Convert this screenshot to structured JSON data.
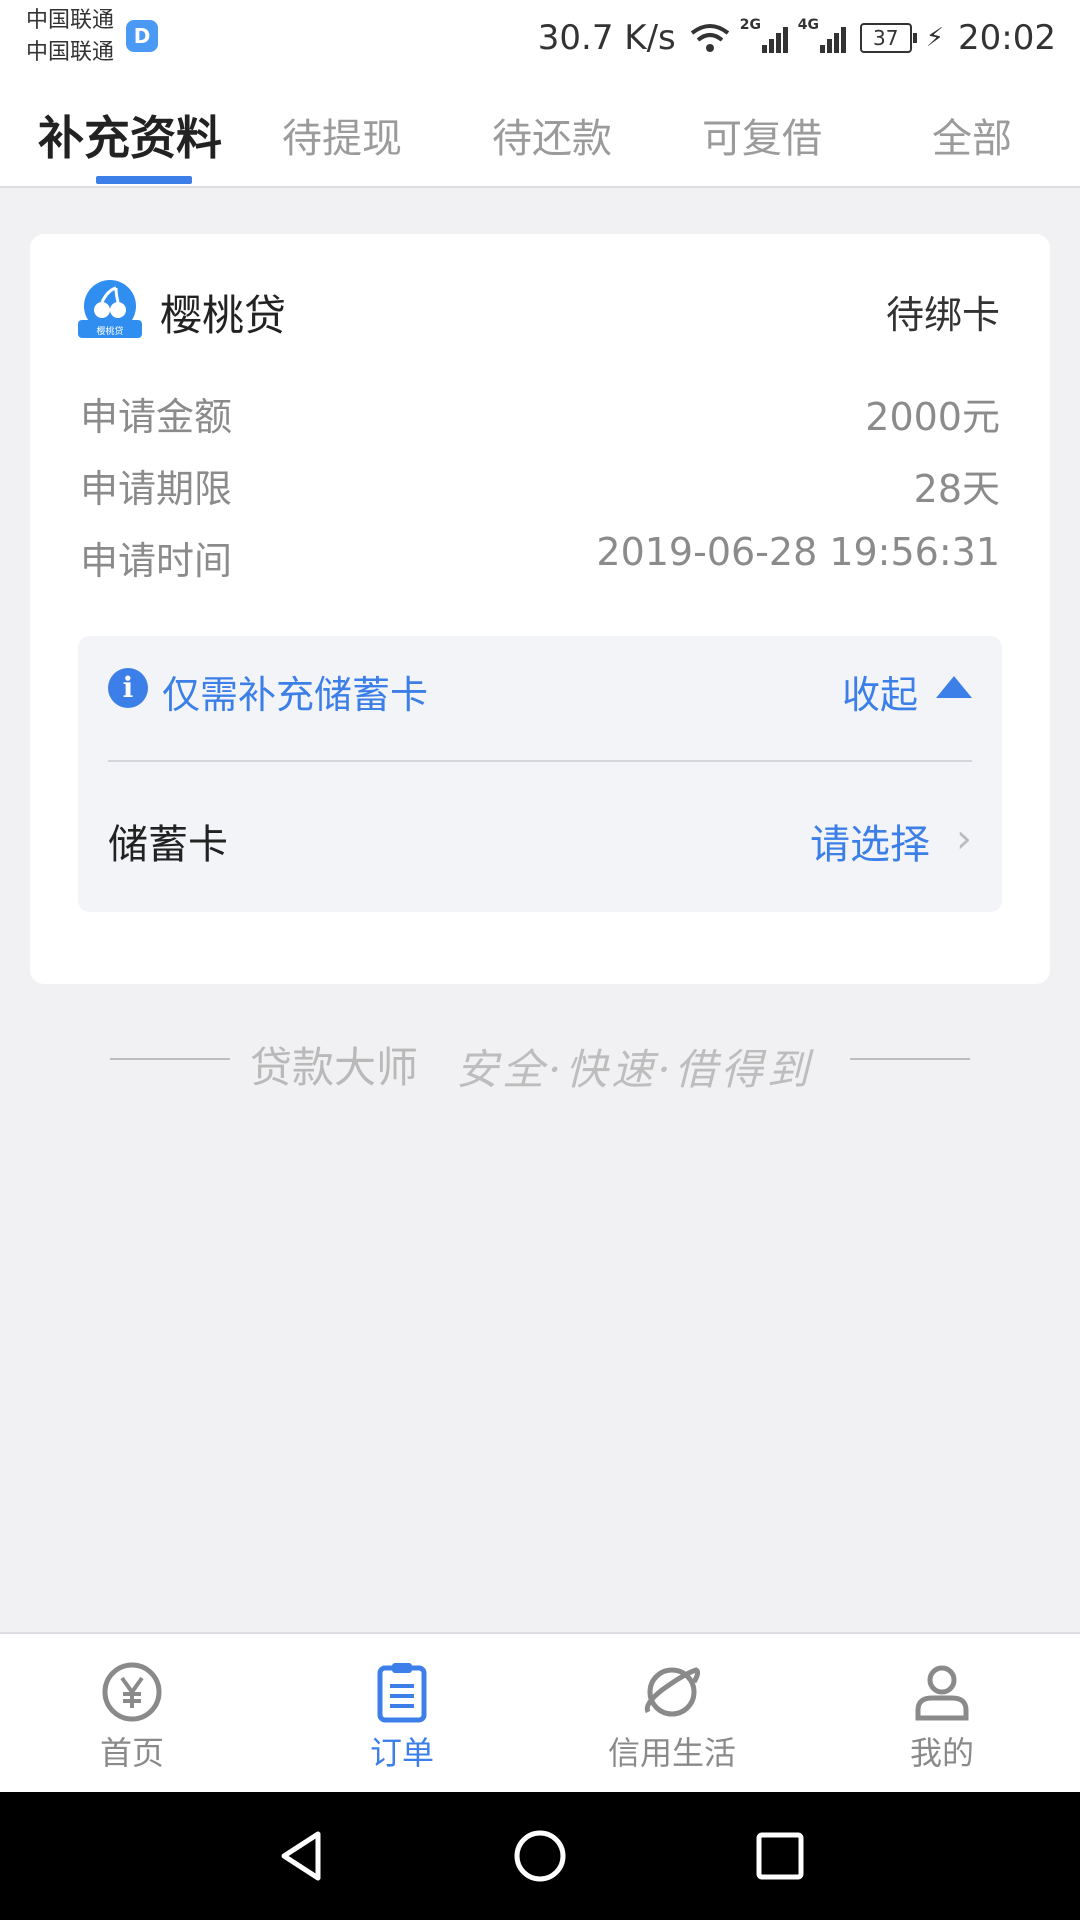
{
  "status_bar": {
    "carrier1": "中国联通",
    "carrier2": "中国联通",
    "app_badge": "D",
    "speed": "30.7 K/s",
    "net1": "2G",
    "net2": "4G",
    "battery": "37",
    "time": "20:02"
  },
  "tabs": [
    {
      "label": "补充资料",
      "active": true
    },
    {
      "label": "待提现"
    },
    {
      "label": "待还款"
    },
    {
      "label": "可复借"
    },
    {
      "label": "全部"
    }
  ],
  "order": {
    "lender": "樱桃贷",
    "logo_caption": "樱桃贷",
    "status": "待绑卡",
    "rows": [
      {
        "label": "申请金额",
        "value": "2000元"
      },
      {
        "label": "申请期限",
        "value": "28天"
      },
      {
        "label": "申请时间",
        "value": "2019-06-28 19:56:31"
      }
    ],
    "notice": "仅需补充储蓄卡",
    "collapse_label": "收起",
    "card_label": "储蓄卡",
    "select_label": "请选择"
  },
  "slogan": {
    "brand": "贷款大师",
    "tagline": "安全·快速·借得到"
  },
  "bottom_nav": [
    {
      "label": "首页",
      "icon": "yen-circle-icon"
    },
    {
      "label": "订单",
      "icon": "clipboard-icon",
      "active": true
    },
    {
      "label": "信用生活",
      "icon": "planet-icon"
    },
    {
      "label": "我的",
      "icon": "user-icon"
    }
  ],
  "colors": {
    "accent": "#3d7fe8",
    "background": "#f1f1f3",
    "muted_text": "#8b8b8b"
  }
}
